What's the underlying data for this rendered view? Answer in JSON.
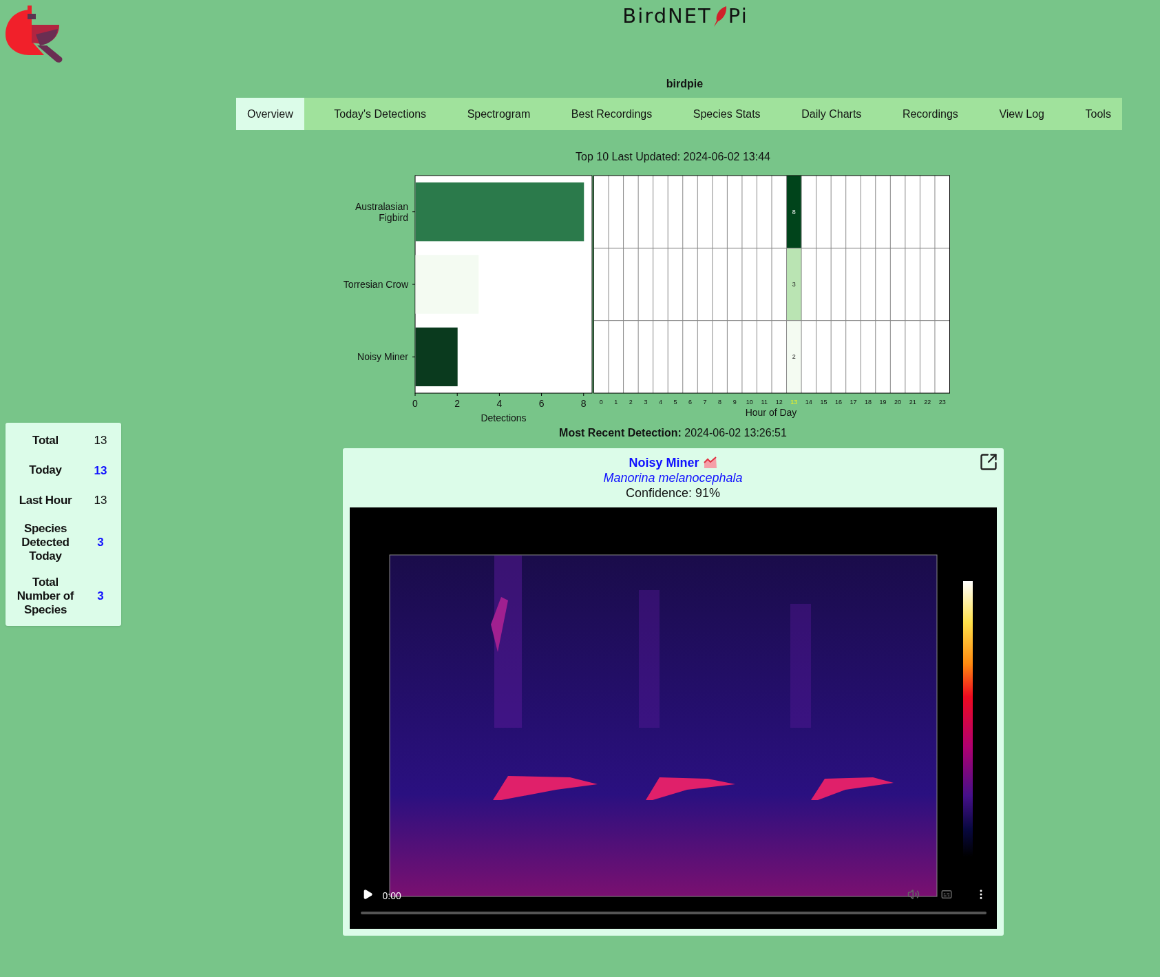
{
  "header": {
    "title_left": "BirdNET",
    "title_right": "Pi",
    "site_name": "birdpie"
  },
  "nav": [
    {
      "label": "Overview",
      "selected": true
    },
    {
      "label": "Today's Detections",
      "selected": false
    },
    {
      "label": "Spectrogram",
      "selected": false
    },
    {
      "label": "Best Recordings",
      "selected": false
    },
    {
      "label": "Species Stats",
      "selected": false
    },
    {
      "label": "Daily Charts",
      "selected": false
    },
    {
      "label": "Recordings",
      "selected": false
    },
    {
      "label": "View Log",
      "selected": false
    },
    {
      "label": "Tools",
      "selected": false
    }
  ],
  "chart_caption": "Top 10 Last Updated: 2024-06-02 13:44",
  "chart_data": {
    "type": "bar",
    "orientation": "horizontal",
    "xlabel": "Detections",
    "categories": [
      "Australasian Figbird",
      "Torresian Crow",
      "Noisy Miner"
    ],
    "values": [
      8,
      3,
      2
    ],
    "colors": [
      "#2b7a4b",
      "#f4fbf2",
      "#0a3a1e"
    ],
    "xlim": [
      0,
      8.4
    ],
    "xticks": [
      0,
      2,
      4,
      6,
      8
    ]
  },
  "hourly_grid": {
    "xlabel": "Hour of Day",
    "hours": [
      {
        "label": "0",
        "current": false
      },
      {
        "label": "1",
        "current": false
      },
      {
        "label": "2",
        "current": false
      },
      {
        "label": "3",
        "current": false
      },
      {
        "label": "4",
        "current": false
      },
      {
        "label": "5",
        "current": false
      },
      {
        "label": "6",
        "current": false
      },
      {
        "label": "7",
        "current": false
      },
      {
        "label": "8",
        "current": false
      },
      {
        "label": "9",
        "current": false
      },
      {
        "label": "10",
        "current": false
      },
      {
        "label": "11",
        "current": false
      },
      {
        "label": "12",
        "current": false
      },
      {
        "label": "13",
        "current": true
      },
      {
        "label": "14",
        "current": false
      },
      {
        "label": "15",
        "current": false
      },
      {
        "label": "16",
        "current": false
      },
      {
        "label": "17",
        "current": false
      },
      {
        "label": "18",
        "current": false
      },
      {
        "label": "19",
        "current": false
      },
      {
        "label": "20",
        "current": false
      },
      {
        "label": "21",
        "current": false
      },
      {
        "label": "22",
        "current": false
      },
      {
        "label": "23",
        "current": false
      }
    ],
    "rows": [
      {
        "cells": [
          null,
          null,
          null,
          null,
          null,
          null,
          null,
          null,
          null,
          null,
          null,
          null,
          null,
          {
            "label": "8",
            "color": "#00441b"
          },
          null,
          null,
          null,
          null,
          null,
          null,
          null,
          null,
          null,
          null
        ]
      },
      {
        "cells": [
          null,
          null,
          null,
          null,
          null,
          null,
          null,
          null,
          null,
          null,
          null,
          null,
          null,
          {
            "label": "3",
            "color": "#bae4b3"
          },
          null,
          null,
          null,
          null,
          null,
          null,
          null,
          null,
          null,
          null
        ]
      },
      {
        "cells": [
          null,
          null,
          null,
          null,
          null,
          null,
          null,
          null,
          null,
          null,
          null,
          null,
          null,
          {
            "label": "2",
            "color": "#f4fbf2"
          },
          null,
          null,
          null,
          null,
          null,
          null,
          null,
          null,
          null,
          null
        ]
      }
    ]
  },
  "stats": [
    {
      "label": "Total",
      "value": "13",
      "link": false
    },
    {
      "label": "Today",
      "value": "13",
      "link": true
    },
    {
      "label": "Last Hour",
      "value": "13",
      "link": false
    },
    {
      "label": "Species Detected Today",
      "value": "3",
      "link": true
    },
    {
      "label": "Total Number of Species",
      "value": "3",
      "link": true
    }
  ],
  "recent": {
    "label": "Most Recent Detection:",
    "time": "2024-06-02 13:26:51"
  },
  "detection": {
    "common_name": "Noisy Miner",
    "scientific_name": "Manorina melanocephala",
    "confidence": "Confidence: 91%",
    "player_time": "0:00"
  }
}
